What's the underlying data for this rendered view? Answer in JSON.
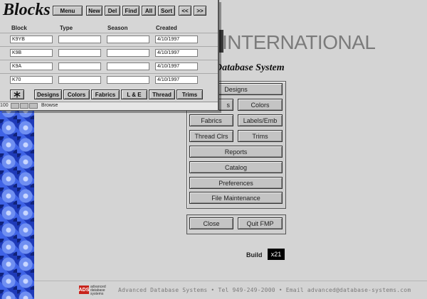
{
  "brand": {
    "partial_title": "INTERNATIONAL",
    "subtitle": "Database System"
  },
  "menu": {
    "designs": "Designs",
    "blocks_partial": "s",
    "colors": "Colors",
    "fabrics": "Fabrics",
    "labels_emb": "Labels/Emb",
    "thread_clrs": "Thread Clrs",
    "trims": "Trims",
    "reports": "Reports",
    "catalog": "Catalog",
    "preferences": "Preferences",
    "file_maintenance": "File Maintenance",
    "close": "Close",
    "quit_fmp": "Quit FMP"
  },
  "build": {
    "label": "Build",
    "value": "x21"
  },
  "footer": {
    "logo_mark": "ADS",
    "logo_text": "advanced database systems",
    "text": "Advanced Database Systems • Tel 949-249-2000 • Email advanced@database-systems.com"
  },
  "window": {
    "title": "Blocks",
    "toolbar": {
      "menu": "Menu",
      "new": "New",
      "del": "Del",
      "find": "Find",
      "all": "All",
      "sort": "Sort",
      "prev": "<<",
      "next": ">>"
    },
    "columns": [
      "Block",
      "Type",
      "Season",
      "Created"
    ],
    "rows": [
      {
        "block": "K9YB",
        "type": "",
        "season": "",
        "created": "4/10/1997"
      },
      {
        "block": "K9B",
        "type": "",
        "season": "",
        "created": "4/10/1997"
      },
      {
        "block": "K9A",
        "type": "",
        "season": "",
        "created": "4/10/1997"
      },
      {
        "block": "K70",
        "type": "",
        "season": "",
        "created": "4/10/1997"
      }
    ],
    "tabs": {
      "icon": "asterisk-icon",
      "designs": "Designs",
      "colors": "Colors",
      "fabrics": "Fabrics",
      "le": "L & E",
      "thread": "Thread",
      "trims": "Trims"
    },
    "status": {
      "zoom": "100",
      "mode": "Browse"
    }
  }
}
